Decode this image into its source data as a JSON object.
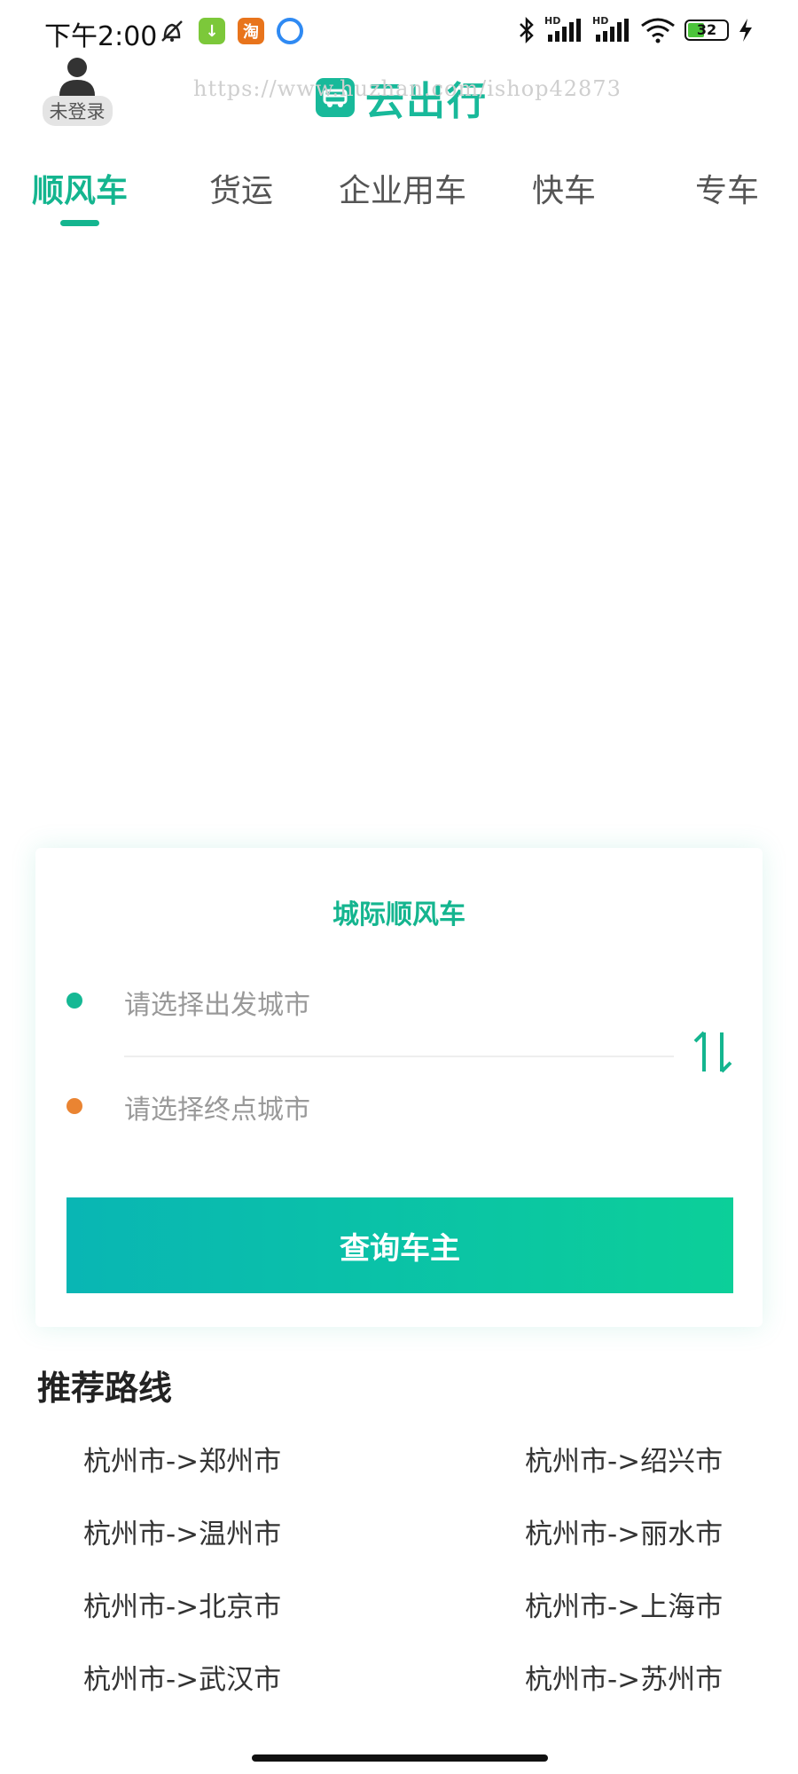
{
  "status_bar": {
    "time": "下午2:00",
    "battery": "32",
    "app_icon_1": "↓",
    "app_icon_2": "淘",
    "network_label_1": "HD",
    "network_label_2": "HD"
  },
  "header": {
    "login_status": "未登录",
    "brand_name": "云出行",
    "watermark": "https://www.huzhan.com/ishop42873"
  },
  "tabs": [
    {
      "label": "顺风车",
      "active": true
    },
    {
      "label": "货运",
      "active": false
    },
    {
      "label": "企业用车",
      "active": false
    },
    {
      "label": "快车",
      "active": false
    },
    {
      "label": "专车",
      "active": false
    }
  ],
  "search_card": {
    "title": "城际顺风车",
    "start_placeholder": "请选择出发城市",
    "end_placeholder": "请选择终点城市",
    "search_button": "查询车主"
  },
  "routes": {
    "title": "推荐路线",
    "items": [
      "杭州市->郑州市",
      "杭州市->绍兴市",
      "杭州市->温州市",
      "杭州市->丽水市",
      "杭州市->北京市",
      "杭州市->上海市",
      "杭州市->武汉市",
      "杭州市->苏州市"
    ]
  },
  "colors": {
    "accent": "#14b58f",
    "start_dot": "#15b894",
    "end_dot": "#ea8432",
    "button_gradient_start": "#09b6b4",
    "button_gradient_end": "#0ccf99"
  }
}
